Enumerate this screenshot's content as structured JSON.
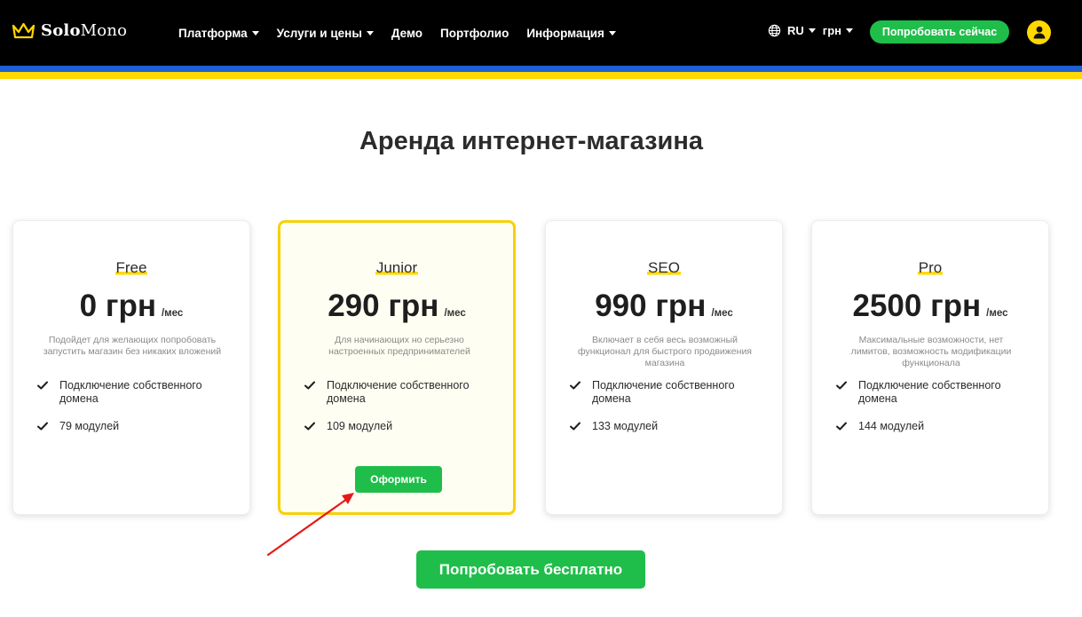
{
  "header": {
    "logo": {
      "bold": "Solo",
      "regular": "Mono",
      "icon": "crown-icon"
    },
    "nav": [
      {
        "label": "Платформа",
        "dropdown": true
      },
      {
        "label": "Услуги и цены",
        "dropdown": true
      },
      {
        "label": "Демо",
        "dropdown": false
      },
      {
        "label": "Портфолио",
        "dropdown": false
      },
      {
        "label": "Информация",
        "dropdown": true
      }
    ],
    "language": "RU",
    "currency": "грн",
    "cta": "Попробовать сейчас",
    "avatar_icon": "user-icon"
  },
  "main": {
    "title": "Аренда интернет-магазина",
    "plans": [
      {
        "name": "Free",
        "price": "0 грн",
        "period": "/мес",
        "description": "Подойдет для желающих попробовать запустить магазин без никаких вложений",
        "features": [
          "Подключение собственного домена",
          "79 модулей"
        ],
        "featured": false
      },
      {
        "name": "Junior",
        "price": "290 грн",
        "period": "/мес",
        "description": "Для начинающих но серьезно настроенных предпринимателей",
        "features": [
          "Подключение собственного домена",
          "109 модулей"
        ],
        "featured": true,
        "button": "Оформить"
      },
      {
        "name": "SEO",
        "price": "990 грн",
        "period": "/мес",
        "description": "Включает в себя весь возможный функционал для быстрого продвижения магазина",
        "features": [
          "Подключение собственного домена",
          "133 модулей"
        ],
        "featured": false
      },
      {
        "name": "Pro",
        "price": "2500 грн",
        "period": "/мес",
        "description": "Максимальные возможности, нет лимитов, возможность модификации функционала",
        "features": [
          "Подключение собственного домена",
          "144 модулей"
        ],
        "featured": false
      }
    ],
    "cta": "Попробовать бесплатно"
  },
  "colors": {
    "header_bg": "#000000",
    "flag_blue": "#1e5fd1",
    "flag_yellow": "#ffd800",
    "accent_green": "#1fbe4a",
    "featured_border": "#f5d20a",
    "annotation_red": "#e31b1b"
  }
}
